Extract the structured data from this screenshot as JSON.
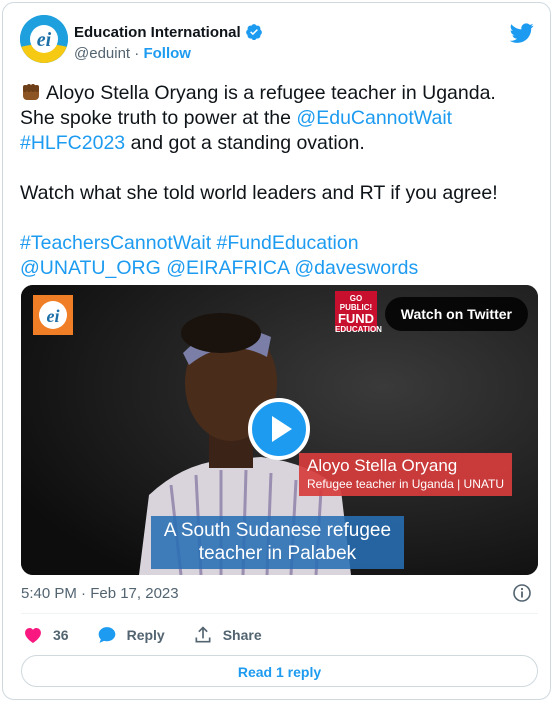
{
  "author": {
    "name": "Education International",
    "handle": "@eduint",
    "separator": "·",
    "follow_label": "Follow"
  },
  "tweet": {
    "line1": "Aloyo Stella Oryang is a refugee teacher in Uganda.",
    "line2_pre": "She spoke truth to power at the ",
    "mention_ecw": "@EduCannotWait",
    "hashtag_hlfc": "#HLFC2023",
    "line3_post": " and got a standing ovation.",
    "para2": "Watch what she told world leaders and RT if you agree!",
    "tag_teachers": "#TeachersCannotWait",
    "tag_fund": "#FundEducation",
    "mention_unatu": "@UNATU_ORG",
    "mention_eiafrica": "@EIRAFRICA",
    "mention_daves": "@daveswords"
  },
  "video": {
    "watch_label": "Watch on Twitter",
    "badge_line1": "GO PUBLIC!",
    "badge_line2": "FUND",
    "badge_line3": "EDUCATION",
    "lower_third_name": "Aloyo Stella Oryang",
    "lower_third_role": "Refugee teacher in Uganda  | UNATU",
    "subtitle": "A South Sudanese refugee teacher in Palabek"
  },
  "meta": {
    "timestamp": "5:40 PM · Feb 17, 2023"
  },
  "actions": {
    "like_count": "36",
    "reply_label": "Reply",
    "share_label": "Share"
  },
  "read_replies_label": "Read 1 reply",
  "colors": {
    "accent": "#1d9bf0",
    "like": "#f91880",
    "text": "#0f1419",
    "secondary": "#536471"
  }
}
